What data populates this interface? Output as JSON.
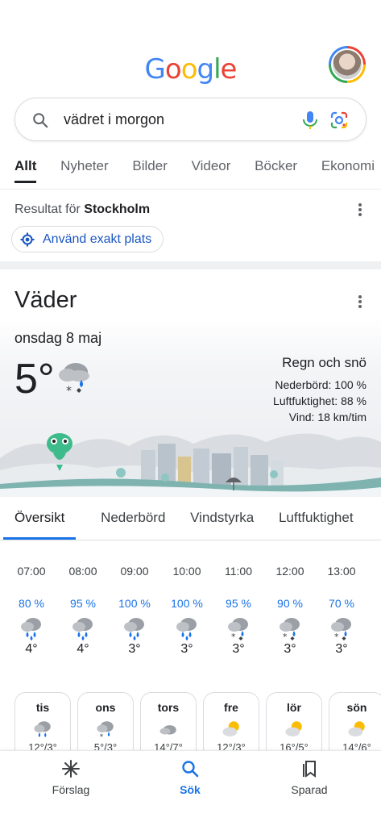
{
  "header": {
    "logo_letters": [
      "G",
      "o",
      "o",
      "g",
      "l",
      "e"
    ],
    "avatar_icon": "user-avatar"
  },
  "search": {
    "query": "vädret i morgon",
    "icons": [
      "search-icon",
      "mic-icon",
      "lens-icon"
    ]
  },
  "tabs": [
    "Allt",
    "Nyheter",
    "Bilder",
    "Videor",
    "Böcker",
    "Ekonomi"
  ],
  "tabs_active": "Allt",
  "location": {
    "prefix": "Resultat för ",
    "city": "Stockholm",
    "exact_button": "Använd exakt plats"
  },
  "weather": {
    "title": "Väder",
    "date": "onsdag 8 maj",
    "temperature": "5°",
    "condition": "Regn och snö",
    "precipitation": "Nederbörd: 100 %",
    "humidity": "Luftfuktighet: 88 %",
    "wind": "Vind: 18 km/tim",
    "subtabs": [
      "Översikt",
      "Nederbörd",
      "Vindstyrka",
      "Luftfuktighet"
    ],
    "hourly": [
      {
        "time": "07:00",
        "precip": "80 %",
        "icon": "rain",
        "temp": "4°"
      },
      {
        "time": "08:00",
        "precip": "95 %",
        "icon": "rain",
        "temp": "4°"
      },
      {
        "time": "09:00",
        "precip": "100 %",
        "icon": "rain",
        "temp": "3°"
      },
      {
        "time": "10:00",
        "precip": "100 %",
        "icon": "rain",
        "temp": "3°"
      },
      {
        "time": "11:00",
        "precip": "95 %",
        "icon": "rain-snow",
        "temp": "3°"
      },
      {
        "time": "12:00",
        "precip": "90 %",
        "icon": "rain-snow",
        "temp": "3°"
      },
      {
        "time": "13:00",
        "precip": "70 %",
        "icon": "rain-snow",
        "temp": "3°"
      }
    ],
    "daily": [
      {
        "day": "tis",
        "icon": "rain",
        "temps": "12°/3°"
      },
      {
        "day": "ons",
        "icon": "rain-snow",
        "temps": "5°/3°"
      },
      {
        "day": "tors",
        "icon": "cloudy",
        "temps": "14°/7°"
      },
      {
        "day": "fre",
        "icon": "partly-sunny",
        "temps": "12°/3°"
      },
      {
        "day": "lör",
        "icon": "partly-sunny",
        "temps": "16°/5°"
      },
      {
        "day": "sön",
        "icon": "partly-sunny",
        "temps": "14°/6°"
      }
    ]
  },
  "bottom_nav": [
    {
      "label": "Förslag",
      "icon": "sparkle-icon"
    },
    {
      "label": "Sök",
      "icon": "search-icon"
    },
    {
      "label": "Sparad",
      "icon": "bookmarks-icon"
    }
  ],
  "colors": {
    "accent": "#1a73e8",
    "text": "#202124",
    "precip_blue": "#1a73e8"
  }
}
